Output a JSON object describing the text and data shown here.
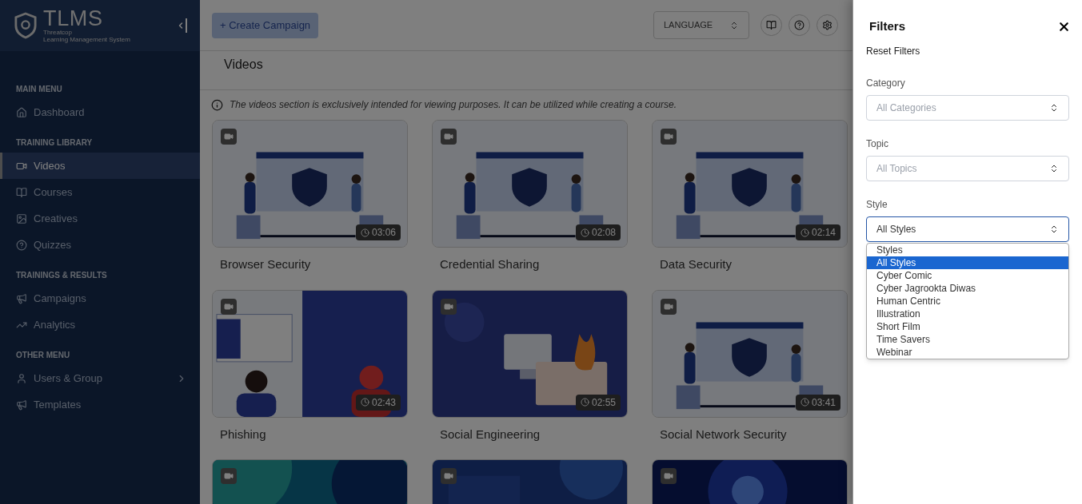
{
  "brand": {
    "name": "TLMS",
    "company": "Threatcop",
    "tagline": "Learning Management System"
  },
  "sidebar": {
    "sections": [
      {
        "heading": "MAIN MENU",
        "items": [
          {
            "label": "Dashboard",
            "selected": false,
            "expandable": false
          }
        ]
      },
      {
        "heading": "TRAINING LIBRARY",
        "items": [
          {
            "label": "Videos",
            "selected": true,
            "expandable": false
          },
          {
            "label": "Courses",
            "selected": false,
            "expandable": false
          },
          {
            "label": "Creatives",
            "selected": false,
            "expandable": false
          },
          {
            "label": "Quizzes",
            "selected": false,
            "expandable": false
          }
        ]
      },
      {
        "heading": "TRAININGS & RESULTS",
        "items": [
          {
            "label": "Campaigns",
            "selected": false,
            "expandable": false
          },
          {
            "label": "Analytics",
            "selected": false,
            "expandable": false
          }
        ]
      },
      {
        "heading": "OTHER MENU",
        "items": [
          {
            "label": "Users & Group",
            "selected": false,
            "expandable": true
          },
          {
            "label": "Templates",
            "selected": false,
            "expandable": false
          }
        ]
      }
    ]
  },
  "toolbar": {
    "create_button": "+ Create Campaign",
    "language": "LANGUAGE"
  },
  "page": {
    "title": "Videos",
    "notice": "The videos section is exclusively intended for viewing purposes. It can be utilized while creating a course."
  },
  "videos": [
    {
      "kind": "video",
      "title": "Browser Security",
      "duration": "03:06"
    },
    {
      "kind": "video",
      "title": "Credential Sharing",
      "duration": "02:08"
    },
    {
      "kind": "video",
      "title": "Data Security",
      "duration": "02:14"
    },
    {
      "kind": "video",
      "title": "Phishing",
      "duration": "02:43"
    },
    {
      "kind": "video",
      "title": "Social Engineering",
      "duration": "02:55"
    },
    {
      "kind": "video",
      "title": "Social Network Security",
      "duration": "03:41"
    },
    {
      "kind": "picture"
    },
    {
      "kind": "picture"
    },
    {
      "kind": "picture"
    }
  ],
  "filters": {
    "title": "Filters",
    "reset": "Reset Filters",
    "fields": [
      {
        "label": "Category",
        "placeholder": "All Categories",
        "focused": false
      },
      {
        "label": "Topic",
        "placeholder": "All Topics",
        "focused": false
      },
      {
        "label": "Style",
        "value": "All Styles",
        "focused": true
      }
    ],
    "style_options": [
      {
        "label": "Styles",
        "selected": false
      },
      {
        "label": "All Styles",
        "selected": true
      },
      {
        "label": "Cyber Comic",
        "selected": false
      },
      {
        "label": "Cyber Jagrookta Diwas",
        "selected": false
      },
      {
        "label": "Human Centric",
        "selected": false
      },
      {
        "label": "Illustration",
        "selected": false
      },
      {
        "label": "Short Film",
        "selected": false
      },
      {
        "label": "Time Savers",
        "selected": false
      },
      {
        "label": "Webinar",
        "selected": false
      }
    ]
  }
}
